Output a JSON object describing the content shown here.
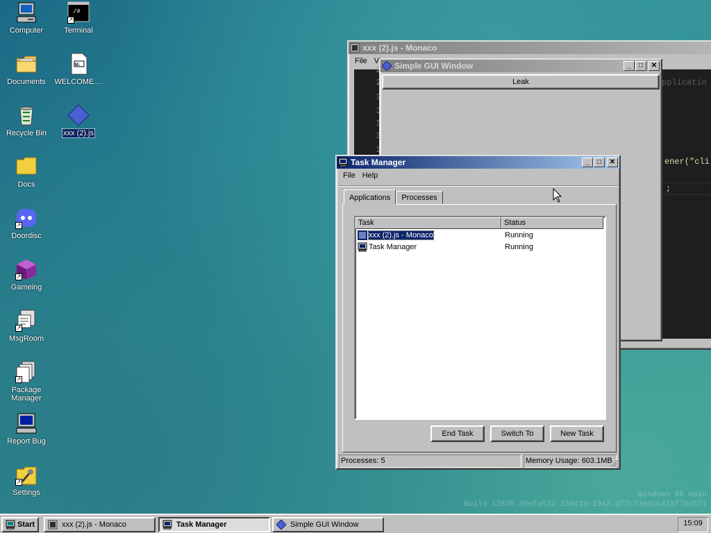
{
  "desktop": {
    "icons": [
      {
        "label": "Computer",
        "icon": "computer-icon"
      },
      {
        "label": "Terminal",
        "icon": "terminal-icon"
      },
      {
        "label": "Documents",
        "icon": "documents-folder-icon"
      },
      {
        "label": "WELCOME....",
        "icon": "markdown-file-icon"
      },
      {
        "label": "Recycle Bin",
        "icon": "recycle-bin-icon"
      },
      {
        "label": "xxx (2).js",
        "icon": "js-file-icon"
      },
      {
        "label": "Docs",
        "icon": "folder-icon"
      },
      {
        "label": "Doordisc",
        "icon": "doordisc-icon"
      },
      {
        "label": "Gameing",
        "icon": "game-cube-icon"
      },
      {
        "label": "MsgRoom",
        "icon": "msgroom-icon"
      },
      {
        "label": "Package Manager",
        "icon": "package-manager-icon"
      },
      {
        "label": "Report Bug",
        "icon": "report-bug-icon"
      },
      {
        "label": "Settings",
        "icon": "settings-icon"
      }
    ],
    "watermark": {
      "line1": "Windows 96 main",
      "line2": "Build 12839.88efa922.230410-1942.d77c73edcc428f7bc571"
    }
  },
  "monaco": {
    "title": "xxx (2).js - Monaco",
    "menu": [
      "File",
      "Vi"
    ],
    "line_numbers": [
      "28",
      "29",
      "30",
      "31",
      "32",
      "33",
      "34"
    ],
    "code_fragments": {
      "a": "pplicatio",
      "b": "ener(\"cli",
      "c": ";"
    }
  },
  "simple_gui": {
    "title": "Simple GUI Window",
    "button_label": "Leak"
  },
  "task_manager": {
    "title": "Task Manager",
    "menu": [
      "File",
      "Help"
    ],
    "tabs": [
      "Applications",
      "Processes"
    ],
    "columns": [
      "Task",
      "Status"
    ],
    "rows": [
      {
        "task": "xxx (2).js - Monaco",
        "status": "Running",
        "selected": true
      },
      {
        "task": "Task Manager",
        "status": "Running",
        "selected": false
      }
    ],
    "buttons": {
      "end_task": "End Task",
      "switch_to": "Switch To",
      "new_task": "New Task"
    },
    "status": {
      "processes": "Processes: 5",
      "memory": "Memory Usage: 603.1MB"
    }
  },
  "taskbar": {
    "start": "Start",
    "items": [
      {
        "label": "xxx (2).js - Monaco",
        "active": false
      },
      {
        "label": "Task Manager",
        "active": true
      },
      {
        "label": "Simple GUI Window",
        "active": false
      }
    ],
    "clock": "15:09"
  },
  "colors": {
    "title_active": "#0a246a",
    "title_inactive": "#808080",
    "selection": "#0a246a",
    "face": "#c0c0c0"
  }
}
